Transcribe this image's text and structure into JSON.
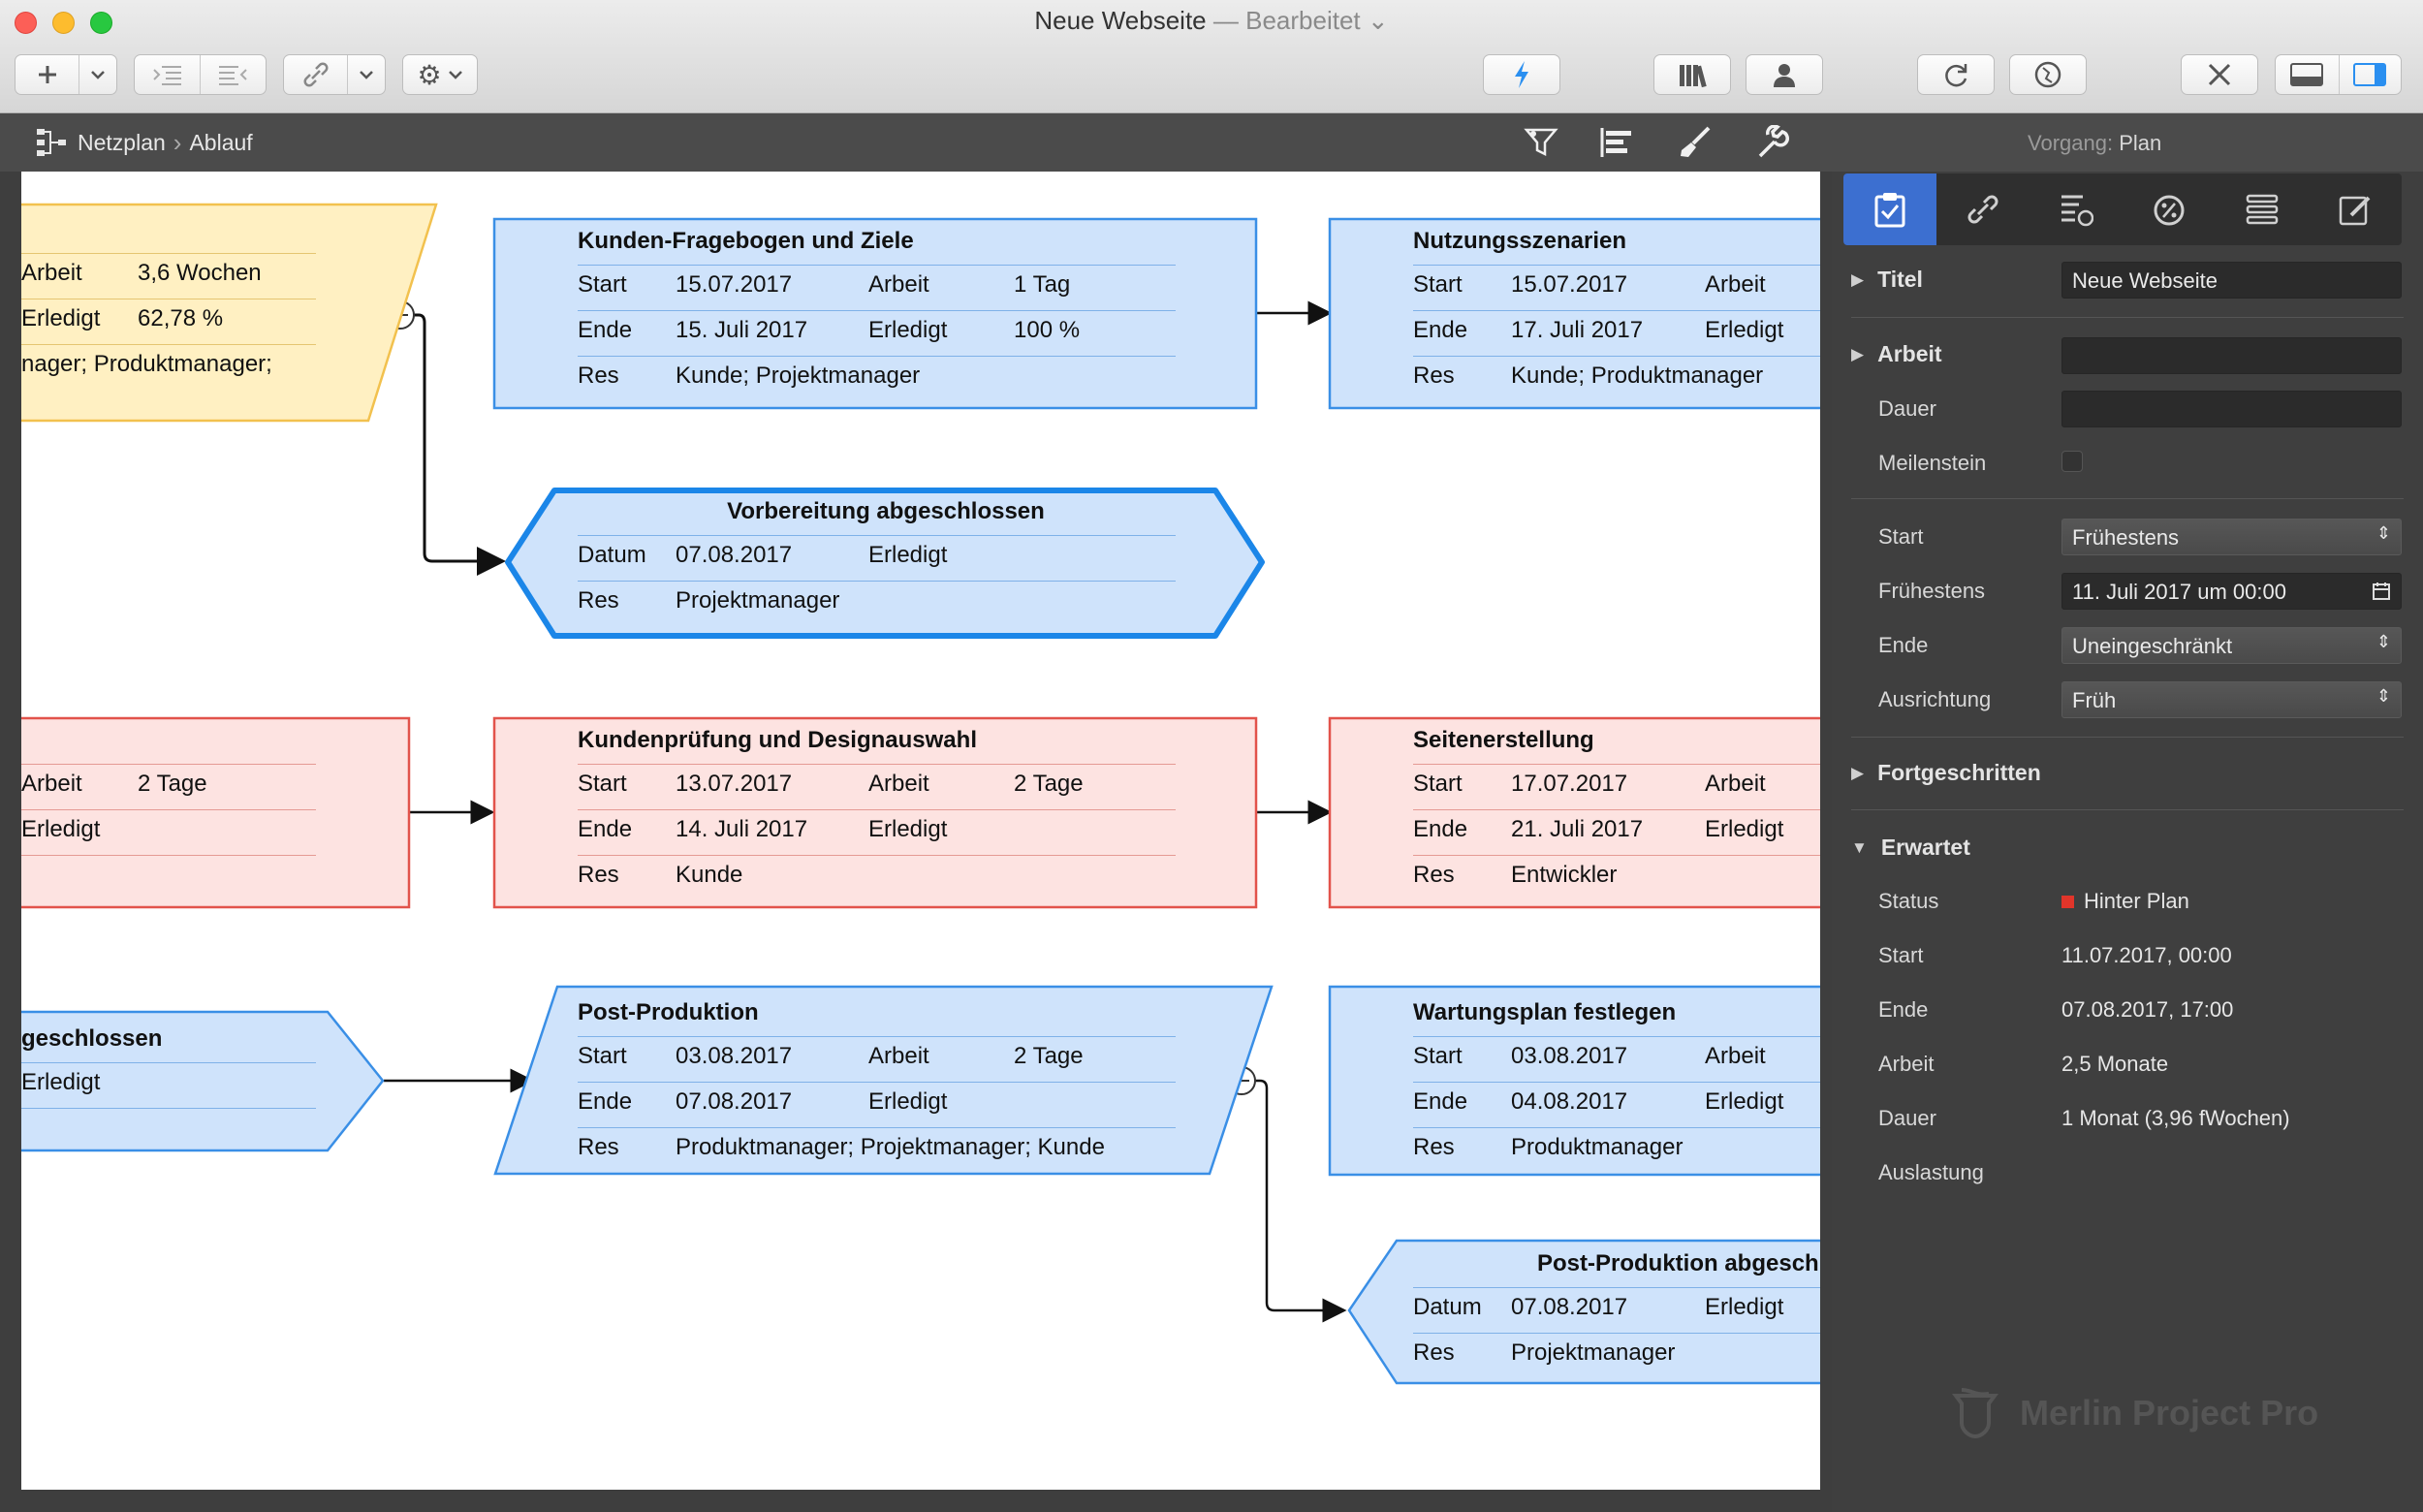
{
  "window": {
    "title": "Neue Webseite",
    "subtitle": "— Bearbeitet",
    "chevron": "⌄"
  },
  "traffic_lights": {
    "close": "#fc5f57",
    "minimize": "#fdbc2e",
    "zoom": "#28c840"
  },
  "toolbar": {
    "add_icon": "plus-icon",
    "dropdown_icon": "chevron-down-icon",
    "indent_icon": "indent-icon",
    "outdent_icon": "outdent-icon",
    "link_icon": "link-icon",
    "gear_icon": "gear-icon",
    "action_icon": "bolt-icon",
    "library_icon": "library-icon",
    "resources_icon": "person-icon",
    "sync_icon": "refresh-icon",
    "web_icon": "globe-icon",
    "tools_icon": "tools-icon",
    "bottom_pane_icon": "bottom-pane-icon",
    "side_pane_icon": "side-pane-icon"
  },
  "breadcrumb": {
    "icon": "netzplan-icon",
    "root": "Netzplan",
    "separator": "›",
    "current": "Ablauf"
  },
  "view_tools": {
    "filter_icon": "filter-icon",
    "align_icon": "align-icon",
    "brush_icon": "brush-icon",
    "wrench_icon": "wrench-icon"
  },
  "vorgang": {
    "label": "Vorgang:",
    "value": "Plan"
  },
  "colors": {
    "blue_fill": "#cfe3fb",
    "blue_stroke": "#3a8fe6",
    "selected_stroke": "#1b86e8",
    "yellow_fill": "#fff0c2",
    "yellow_stroke": "#f2c14e",
    "red_fill": "#fde3e1",
    "red_stroke": "#e2534b",
    "rule_blue": "#7fb1e8",
    "rule_yellow": "#e5c571",
    "rule_red": "#e59a94",
    "accent": "#3c6fd0",
    "status_red": "#e1352a"
  },
  "nodes": {
    "n1": {
      "r1": [
        "Arbeit",
        "3,6 Wochen"
      ],
      "r2": [
        "Erledigt",
        "62,78 %"
      ],
      "r3": [
        "nager; Produktmanager;"
      ]
    },
    "n2": {
      "title": "Kunden-Fragebogen und Ziele",
      "r1": [
        "Start",
        "15.07.2017",
        "Arbeit",
        "1 Tag"
      ],
      "r2": [
        "Ende",
        "15. Juli 2017",
        "Erledigt",
        "100 %"
      ],
      "r3": [
        "Res",
        "Kunde; Projektmanager"
      ]
    },
    "n3": {
      "title": "Nutzungsszenarien",
      "r1": [
        "Start",
        "15.07.2017",
        "Arbeit"
      ],
      "r2": [
        "Ende",
        "17. Juli 2017",
        "Erledigt"
      ],
      "r3": [
        "Res",
        "Kunde; Produktmanager"
      ]
    },
    "n4": {
      "title": "Vorbereitung abgeschlossen",
      "r1": [
        "Datum",
        "07.08.2017",
        "Erledigt"
      ],
      "r2": [
        "Res",
        "Projektmanager"
      ]
    },
    "n5": {
      "r1": [
        "Arbeit",
        "2 Tage"
      ],
      "r2": [
        "Erledigt"
      ]
    },
    "n6": {
      "title": "Kundenprüfung und Designauswahl",
      "r1": [
        "Start",
        "13.07.2017",
        "Arbeit",
        "2 Tage"
      ],
      "r2": [
        "Ende",
        "14. Juli 2017",
        "Erledigt"
      ],
      "r3": [
        "Res",
        "Kunde"
      ]
    },
    "n7": {
      "title": "Seitenerstellung",
      "r1": [
        "Start",
        "17.07.2017",
        "Arbeit"
      ],
      "r2": [
        "Ende",
        "21. Juli 2017",
        "Erledigt"
      ],
      "r3": [
        "Res",
        "Entwickler"
      ]
    },
    "n8": {
      "title": "geschlossen",
      "r1": [
        "Erledigt"
      ]
    },
    "n9": {
      "title": "Post-Produktion",
      "r1": [
        "Start",
        "03.08.2017",
        "Arbeit",
        "2 Tage"
      ],
      "r2": [
        "Ende",
        "07.08.2017",
        "Erledigt"
      ],
      "r3": [
        "Res",
        "Produktmanager; Projektmanager; Kunde"
      ]
    },
    "n10": {
      "title": "Wartungsplan festlegen",
      "r1": [
        "Start",
        "03.08.2017",
        "Arbeit"
      ],
      "r2": [
        "Ende",
        "04.08.2017",
        "Erledigt"
      ],
      "r3": [
        "Res",
        "Produktmanager"
      ]
    },
    "n11": {
      "title": "Post-Produktion abgeschl",
      "r1": [
        "Datum",
        "07.08.2017",
        "Erledigt"
      ],
      "r2": [
        "Res",
        "Projektmanager"
      ]
    }
  },
  "inspector": {
    "tabs": [
      "clipboard-check-icon",
      "link-icon",
      "cost-icon",
      "percent-icon",
      "list-icon",
      "edit-icon"
    ],
    "titel": {
      "label": "Titel",
      "value": "Neue Webseite"
    },
    "arbeit": {
      "label": "Arbeit",
      "value": ""
    },
    "dauer": {
      "label": "Dauer",
      "value": ""
    },
    "meilenstein": {
      "label": "Meilenstein"
    },
    "start": {
      "label": "Start",
      "value": "Frühestens"
    },
    "fruehestens": {
      "label": "Frühestens",
      "value": "11. Juli 2017 um 00:00"
    },
    "ende": {
      "label": "Ende",
      "value": "Uneingeschränkt"
    },
    "ausrichtung": {
      "label": "Ausrichtung",
      "value": "Früh"
    },
    "fortgeschritten": "Fortgeschritten",
    "erwartet": {
      "label": "Erwartet",
      "status_label": "Status",
      "status_value": "Hinter Plan",
      "start_label": "Start",
      "start_value": "11.07.2017, 00:00",
      "ende_label": "Ende",
      "ende_value": "07.08.2017, 17:00",
      "arbeit_label": "Arbeit",
      "arbeit_value": "2,5 Monate",
      "dauer_label": "Dauer",
      "dauer_value": "1 Monat (3,96 fWochen)",
      "auslastung_label": "Auslastung"
    }
  },
  "brand": "Merlin Project Pro"
}
